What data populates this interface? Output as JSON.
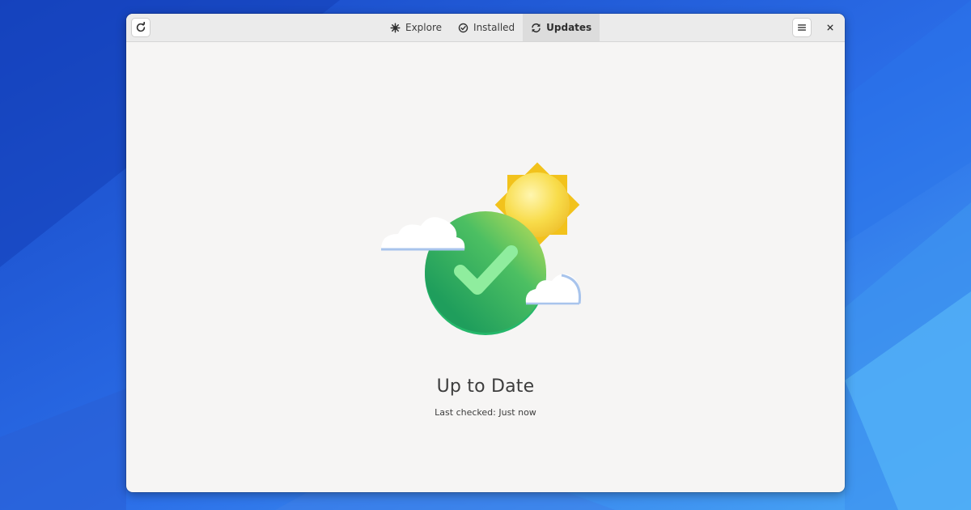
{
  "headerbar": {
    "refresh_icon": "refresh-icon",
    "menu_icon": "hamburger-menu-icon",
    "close_icon": "close-icon",
    "tabs": [
      {
        "label": "Explore",
        "icon": "explore-star-icon",
        "active": false
      },
      {
        "label": "Installed",
        "icon": "check-circle-icon",
        "active": false
      },
      {
        "label": "Updates",
        "icon": "sync-arrows-icon",
        "active": true
      }
    ]
  },
  "status": {
    "title": "Up to Date",
    "subtitle": "Last checked: Just now",
    "illustration": "up-to-date-illustration"
  },
  "colors": {
    "desktop_blue": "#1f5fd9",
    "window_bg": "#f6f5f4",
    "headerbar_bg": "#ebebeb",
    "check_green": "#2eb36b",
    "sun_yellow": "#f6d33c"
  }
}
